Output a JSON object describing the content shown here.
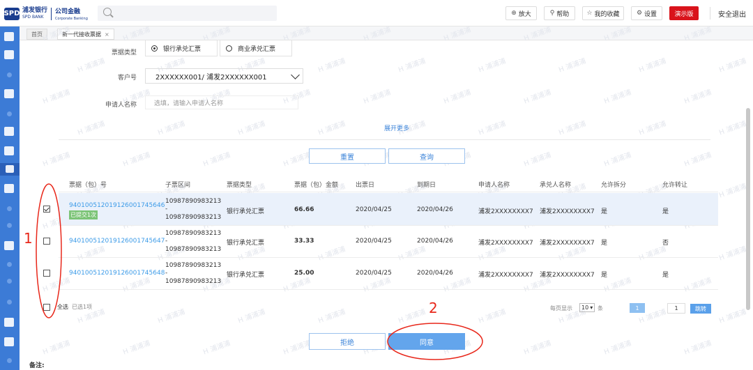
{
  "header": {
    "logo_cn": "浦发银行",
    "logo_en": "SPD BANK",
    "logo_sub_cn": "公司金融",
    "logo_sub_en": "Corporate Banking",
    "buttons": {
      "zoom": "放大",
      "help": "帮助",
      "favorites": "我的收藏",
      "settings": "设置",
      "demo": "演示版"
    },
    "logout": "安全退出"
  },
  "tabs": [
    {
      "label": "首页"
    },
    {
      "label": "新一代接收票据"
    }
  ],
  "form": {
    "bill_type_label": "票据类型",
    "bill_type_options": [
      "银行承兑汇票",
      "商业承兑汇票"
    ],
    "bill_type_selected": "银行承兑汇票",
    "customer_label": "客户号",
    "customer_value": "2XXXXXX001/ 浦发2XXXXXX001",
    "applicant_label": "申请人名称",
    "applicant_placeholder": "选填，请输入申请人名称",
    "expand_more": "展开更多",
    "reset": "重置",
    "query": "查询"
  },
  "table": {
    "columns": [
      "票据（包）号",
      "子票区间",
      "票据类型",
      "票据（包）金额",
      "出票日",
      "到期日",
      "申请人名称",
      "承兑人名称",
      "允许拆分",
      "允许转让"
    ],
    "rows": [
      {
        "selected": true,
        "no": "940100512019126001745646",
        "badge": "已提交1次",
        "range_start": "10987890983213",
        "range_sep": "-",
        "range_end": "10987890983213",
        "type": "银行承兑汇票",
        "amount": "66.66",
        "issue_date": "2020/04/25",
        "due_date": "2020/04/26",
        "applicant": "浦发2XXXXXXXX7",
        "acceptor": "浦发2XXXXXXXX7",
        "split": "是",
        "transfer": "是"
      },
      {
        "selected": false,
        "no": "940100512019126001745647",
        "badge": "",
        "range_start": "10987890983213",
        "range_sep": "-",
        "range_end": "10987890983213",
        "type": "银行承兑汇票",
        "amount": "33.33",
        "issue_date": "2020/04/25",
        "due_date": "2020/04/26",
        "applicant": "浦发2XXXXXXXX7",
        "acceptor": "浦发2XXXXXXXX7",
        "split": "是",
        "transfer": "否"
      },
      {
        "selected": false,
        "no": "940100512019126001745648",
        "badge": "",
        "range_start": "10987890983213",
        "range_sep": "-",
        "range_end": "10987890983213",
        "type": "银行承兑汇票",
        "amount": "25.00",
        "issue_date": "2020/04/25",
        "due_date": "2020/04/26",
        "applicant": "浦发2XXXXXXXX7",
        "acceptor": "浦发2XXXXXXXX7",
        "split": "是",
        "transfer": "是"
      }
    ]
  },
  "footer": {
    "select_all": "全选",
    "selected_count": "已选1项",
    "per_page_label": "每页显示",
    "per_page_value": "10",
    "per_page_unit": "条",
    "current_page": "1",
    "goto_page": "1",
    "goto": "跳转"
  },
  "actions": {
    "reject": "拒绝",
    "agree": "同意"
  },
  "annotations": {
    "num1": "1",
    "num2": "2"
  },
  "note_label": "备注:",
  "watermark": "H 浦浦浦"
}
